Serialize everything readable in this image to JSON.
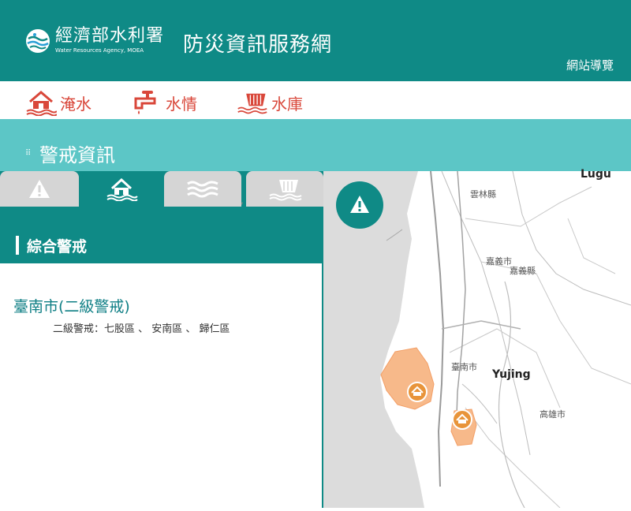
{
  "header": {
    "agency_name": "經濟部水利署",
    "agency_en": "Water Resources Agency, MOEA",
    "site_title": "防災資訊服務網",
    "sitemap_label": "網站導覽"
  },
  "nav": {
    "items": [
      {
        "label": "淹水",
        "icon": "flood-house-icon"
      },
      {
        "label": "水情",
        "icon": "faucet-icon"
      },
      {
        "label": "水庫",
        "icon": "dam-icon"
      }
    ]
  },
  "section": {
    "title": "警戒資訊"
  },
  "tabs": [
    {
      "icon": "warning-icon",
      "active": false
    },
    {
      "icon": "flood-house-icon",
      "active": true
    },
    {
      "icon": "waves-icon",
      "active": false
    },
    {
      "icon": "dam-icon",
      "active": false
    }
  ],
  "tab_separator": ",",
  "summary": {
    "title": "綜合警戒"
  },
  "alert": {
    "city": "臺南市(二級警戒)",
    "detail": "二級警戒：七股區 、 安南區 、 歸仁區"
  },
  "map": {
    "labels": {
      "lugu": "Lugu",
      "yunlin": "雲林縣",
      "chiayi_city": "嘉義市",
      "chiayi_county": "嘉義縣",
      "tainan": "臺南市",
      "yujing": "Yujing",
      "kaohsiung": "高雄市"
    },
    "alert_zone_color": "#f7b98a",
    "marker_color": "#e8943a"
  },
  "colors": {
    "primary": "#0f8a86",
    "secondary": "#5cc6c6",
    "accent": "#d9473a"
  }
}
